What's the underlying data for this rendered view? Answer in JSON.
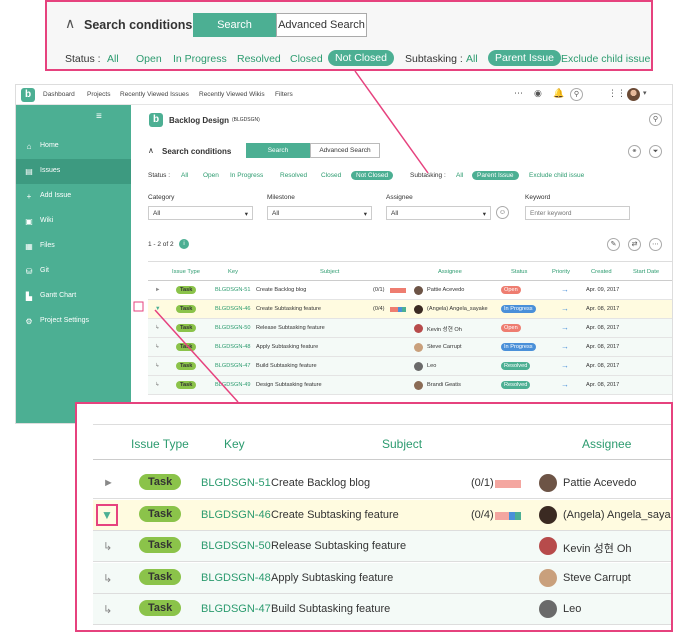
{
  "colors": {
    "accent": "#4caf93",
    "highlight": "#e6427e",
    "task": "#8bc34a",
    "open": "#ee7d70",
    "in_progress": "#4a90d9",
    "resolved": "#4caf93"
  },
  "nav": {
    "links": [
      "Dashboard",
      "Projects",
      "Recently Viewed Issues",
      "Recently Viewed Wikis",
      "Filters"
    ]
  },
  "sidebar": {
    "items": [
      {
        "label": "Home",
        "icon": "home-icon"
      },
      {
        "label": "Issues",
        "icon": "issues-icon"
      },
      {
        "label": "Add Issue",
        "icon": "plus-icon"
      },
      {
        "label": "Wiki",
        "icon": "wiki-icon"
      },
      {
        "label": "Files",
        "icon": "files-icon"
      },
      {
        "label": "Git",
        "icon": "git-icon"
      },
      {
        "label": "Gantt Chart",
        "icon": "gantt-icon"
      },
      {
        "label": "Project Settings",
        "icon": "gear-icon"
      }
    ]
  },
  "project": {
    "name": "Backlog Design",
    "key": "(BLGDSGN)"
  },
  "search": {
    "title": "Search conditions",
    "tab_search": "Search",
    "tab_advanced": "Advanced Search",
    "status_label": "Status :",
    "status_options": [
      "All",
      "Open",
      "In Progress",
      "Resolved",
      "Closed",
      "Not Closed"
    ],
    "subtasking_label": "Subtasking :",
    "subtasking_options": [
      "All",
      "Parent Issue",
      "Exclude child issue"
    ],
    "category_label": "Category",
    "category_value": "All",
    "milestone_label": "Milestone",
    "milestone_value": "All",
    "assignee_label": "Assignee",
    "assignee_value": "All",
    "keyword_label": "Keyword",
    "keyword_placeholder": "Enter keyword"
  },
  "results": {
    "range": "1 - 2 of 2",
    "count": "i"
  },
  "columns": [
    "Issue Type",
    "Key",
    "Subject",
    "Assignee",
    "Status",
    "Priority",
    "Created",
    "Start Date"
  ],
  "issues": [
    {
      "type": "Task",
      "key": "BLGDSGN-51",
      "subject": "Create Backlog blog",
      "subtasks": "(0/1)",
      "assignee": "Pattie Acevedo",
      "status": "Open",
      "created": "Apr. 09, 2017",
      "expander": "►",
      "progress": [
        1,
        0,
        0
      ]
    },
    {
      "type": "Task",
      "key": "BLGDSGN-46",
      "subject": "Create Subtasking feature",
      "subtasks": "(0/4)",
      "assignee": "(Angela) Angela_sayake",
      "status": "In Progress",
      "created": "Apr. 08, 2017",
      "expander": "▼",
      "progress": [
        0.5,
        0.25,
        0.25
      ]
    },
    {
      "type": "Task",
      "key": "BLGDSGN-50",
      "subject": "Release Subtasking feature",
      "subtasks": "",
      "assignee": "Kevin 성현 Oh",
      "status": "Open",
      "created": "Apr. 08, 2017",
      "expander": "↳"
    },
    {
      "type": "Task",
      "key": "BLGDSGN-48",
      "subject": "Apply Subtasking feature",
      "subtasks": "",
      "assignee": "Steve Carrupt",
      "status": "In Progress",
      "created": "Apr. 08, 2017",
      "expander": "↳"
    },
    {
      "type": "Task",
      "key": "BLGDSGN-47",
      "subject": "Build Subtasking feature",
      "subtasks": "",
      "assignee": "Leo",
      "status": "Resolved",
      "created": "Apr. 08, 2017",
      "expander": "↳"
    },
    {
      "type": "Task",
      "key": "BLGDSGN-49",
      "subject": "Design Subtasking feature",
      "subtasks": "",
      "assignee": "Brandi Geatis",
      "status": "Resolved",
      "created": "Apr. 08, 2017",
      "expander": "↳"
    }
  ],
  "zoom_issues": [
    {
      "type": "Task",
      "key": "BLGDSGN-51",
      "subject": "Create Backlog blog",
      "subtasks": "(0/1)",
      "assignee": "Pattie Acevedo",
      "expander": "►"
    },
    {
      "type": "Task",
      "key": "BLGDSGN-46",
      "subject": "Create Subtasking feature",
      "subtasks": "(0/4)",
      "assignee": "(Angela) Angela_sayak",
      "expander": "▼"
    },
    {
      "type": "Task",
      "key": "BLGDSGN-50",
      "subject": "Release Subtasking feature",
      "subtasks": "",
      "assignee": "Kevin 성현 Oh",
      "expander": "↳"
    },
    {
      "type": "Task",
      "key": "BLGDSGN-48",
      "subject": "Apply Subtasking feature",
      "subtasks": "",
      "assignee": "Steve Carrupt",
      "expander": "↳"
    },
    {
      "type": "Task",
      "key": "BLGDSGN-47",
      "subject": "Build Subtasking feature",
      "subtasks": "",
      "assignee": "Leo",
      "expander": "↳"
    }
  ],
  "zoom_columns": [
    "Issue Type",
    "Key",
    "Subject",
    "Assignee"
  ]
}
